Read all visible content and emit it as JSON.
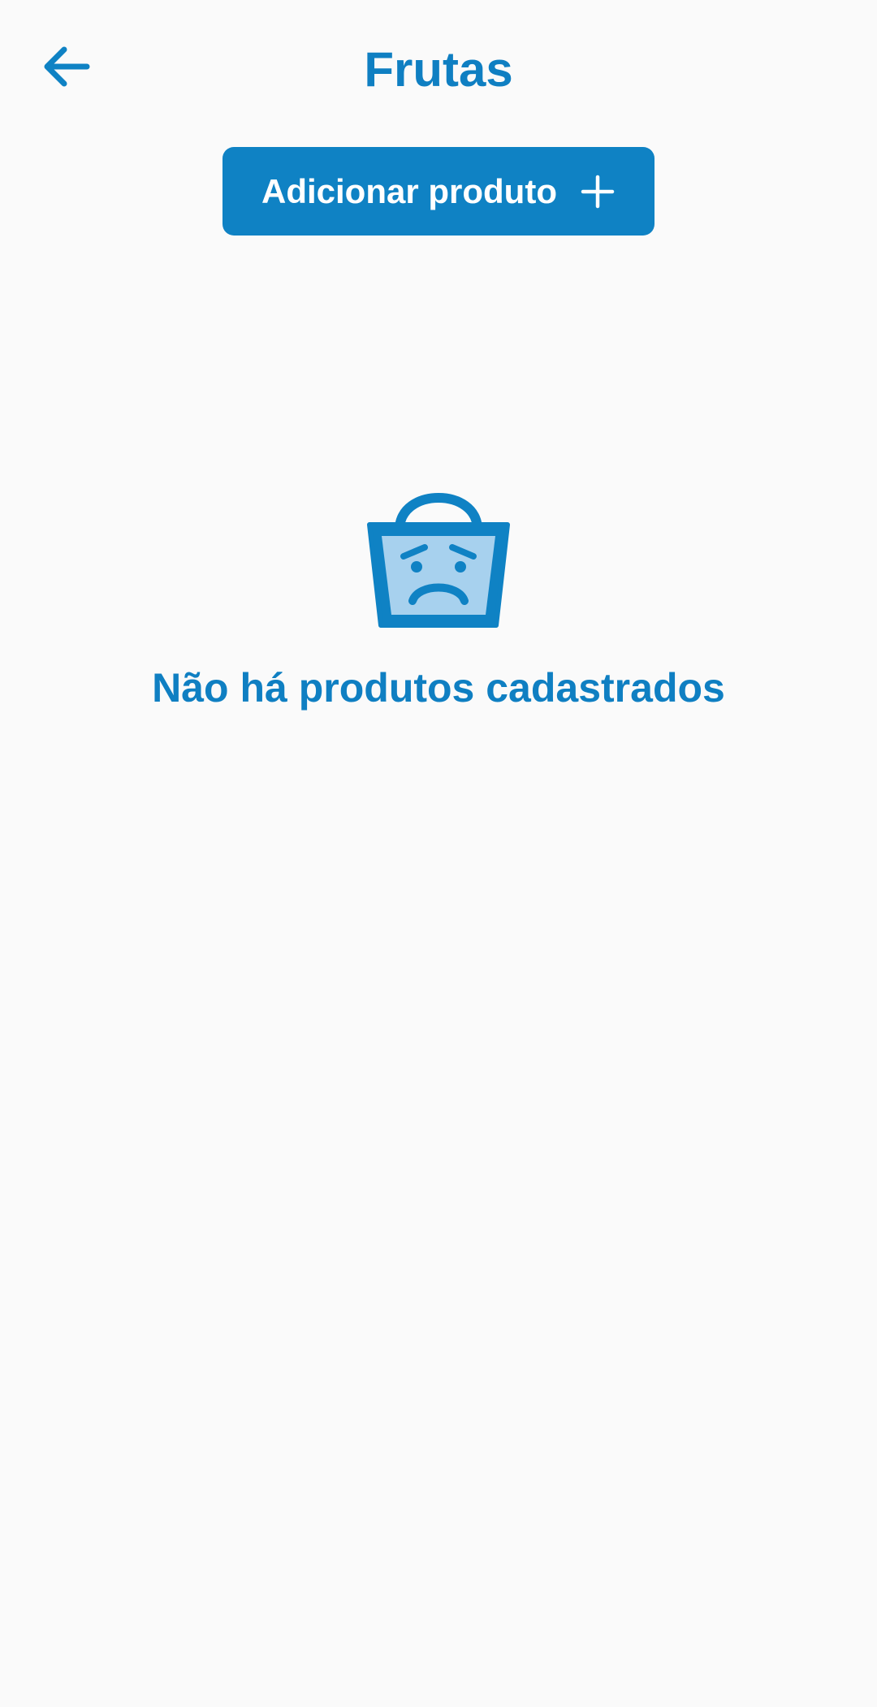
{
  "header": {
    "title": "Frutas",
    "back_icon": "arrow-left-icon"
  },
  "actions": {
    "add_product_label": "Adicionar produto",
    "add_icon": "plus-icon"
  },
  "empty_state": {
    "icon": "sad-basket-icon",
    "message": "Não há produtos cadastrados"
  },
  "colors": {
    "primary": "#0f82c4",
    "primary_text": "#0f7fc2",
    "icon_fill_light": "#a7d1ee",
    "background": "#fafafa"
  }
}
